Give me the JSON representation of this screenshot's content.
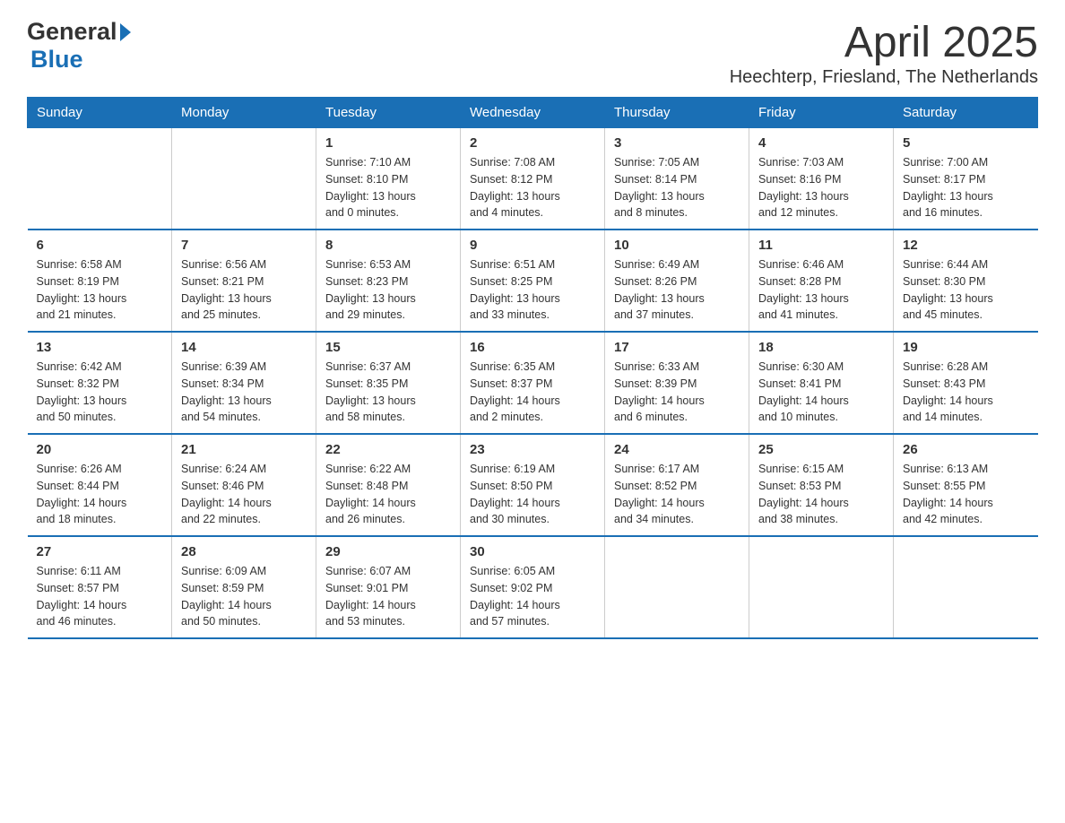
{
  "header": {
    "logo": {
      "general": "General",
      "blue": "Blue"
    },
    "month": "April 2025",
    "location": "Heechterp, Friesland, The Netherlands"
  },
  "days_of_week": [
    "Sunday",
    "Monday",
    "Tuesday",
    "Wednesday",
    "Thursday",
    "Friday",
    "Saturday"
  ],
  "weeks": [
    [
      {
        "day": "",
        "sunrise": "",
        "sunset": "",
        "daylight": ""
      },
      {
        "day": "",
        "sunrise": "",
        "sunset": "",
        "daylight": ""
      },
      {
        "day": "1",
        "sunrise": "Sunrise: 7:10 AM",
        "sunset": "Sunset: 8:10 PM",
        "daylight": "Daylight: 13 hours and 0 minutes."
      },
      {
        "day": "2",
        "sunrise": "Sunrise: 7:08 AM",
        "sunset": "Sunset: 8:12 PM",
        "daylight": "Daylight: 13 hours and 4 minutes."
      },
      {
        "day": "3",
        "sunrise": "Sunrise: 7:05 AM",
        "sunset": "Sunset: 8:14 PM",
        "daylight": "Daylight: 13 hours and 8 minutes."
      },
      {
        "day": "4",
        "sunrise": "Sunrise: 7:03 AM",
        "sunset": "Sunset: 8:16 PM",
        "daylight": "Daylight: 13 hours and 12 minutes."
      },
      {
        "day": "5",
        "sunrise": "Sunrise: 7:00 AM",
        "sunset": "Sunset: 8:17 PM",
        "daylight": "Daylight: 13 hours and 16 minutes."
      }
    ],
    [
      {
        "day": "6",
        "sunrise": "Sunrise: 6:58 AM",
        "sunset": "Sunset: 8:19 PM",
        "daylight": "Daylight: 13 hours and 21 minutes."
      },
      {
        "day": "7",
        "sunrise": "Sunrise: 6:56 AM",
        "sunset": "Sunset: 8:21 PM",
        "daylight": "Daylight: 13 hours and 25 minutes."
      },
      {
        "day": "8",
        "sunrise": "Sunrise: 6:53 AM",
        "sunset": "Sunset: 8:23 PM",
        "daylight": "Daylight: 13 hours and 29 minutes."
      },
      {
        "day": "9",
        "sunrise": "Sunrise: 6:51 AM",
        "sunset": "Sunset: 8:25 PM",
        "daylight": "Daylight: 13 hours and 33 minutes."
      },
      {
        "day": "10",
        "sunrise": "Sunrise: 6:49 AM",
        "sunset": "Sunset: 8:26 PM",
        "daylight": "Daylight: 13 hours and 37 minutes."
      },
      {
        "day": "11",
        "sunrise": "Sunrise: 6:46 AM",
        "sunset": "Sunset: 8:28 PM",
        "daylight": "Daylight: 13 hours and 41 minutes."
      },
      {
        "day": "12",
        "sunrise": "Sunrise: 6:44 AM",
        "sunset": "Sunset: 8:30 PM",
        "daylight": "Daylight: 13 hours and 45 minutes."
      }
    ],
    [
      {
        "day": "13",
        "sunrise": "Sunrise: 6:42 AM",
        "sunset": "Sunset: 8:32 PM",
        "daylight": "Daylight: 13 hours and 50 minutes."
      },
      {
        "day": "14",
        "sunrise": "Sunrise: 6:39 AM",
        "sunset": "Sunset: 8:34 PM",
        "daylight": "Daylight: 13 hours and 54 minutes."
      },
      {
        "day": "15",
        "sunrise": "Sunrise: 6:37 AM",
        "sunset": "Sunset: 8:35 PM",
        "daylight": "Daylight: 13 hours and 58 minutes."
      },
      {
        "day": "16",
        "sunrise": "Sunrise: 6:35 AM",
        "sunset": "Sunset: 8:37 PM",
        "daylight": "Daylight: 14 hours and 2 minutes."
      },
      {
        "day": "17",
        "sunrise": "Sunrise: 6:33 AM",
        "sunset": "Sunset: 8:39 PM",
        "daylight": "Daylight: 14 hours and 6 minutes."
      },
      {
        "day": "18",
        "sunrise": "Sunrise: 6:30 AM",
        "sunset": "Sunset: 8:41 PM",
        "daylight": "Daylight: 14 hours and 10 minutes."
      },
      {
        "day": "19",
        "sunrise": "Sunrise: 6:28 AM",
        "sunset": "Sunset: 8:43 PM",
        "daylight": "Daylight: 14 hours and 14 minutes."
      }
    ],
    [
      {
        "day": "20",
        "sunrise": "Sunrise: 6:26 AM",
        "sunset": "Sunset: 8:44 PM",
        "daylight": "Daylight: 14 hours and 18 minutes."
      },
      {
        "day": "21",
        "sunrise": "Sunrise: 6:24 AM",
        "sunset": "Sunset: 8:46 PM",
        "daylight": "Daylight: 14 hours and 22 minutes."
      },
      {
        "day": "22",
        "sunrise": "Sunrise: 6:22 AM",
        "sunset": "Sunset: 8:48 PM",
        "daylight": "Daylight: 14 hours and 26 minutes."
      },
      {
        "day": "23",
        "sunrise": "Sunrise: 6:19 AM",
        "sunset": "Sunset: 8:50 PM",
        "daylight": "Daylight: 14 hours and 30 minutes."
      },
      {
        "day": "24",
        "sunrise": "Sunrise: 6:17 AM",
        "sunset": "Sunset: 8:52 PM",
        "daylight": "Daylight: 14 hours and 34 minutes."
      },
      {
        "day": "25",
        "sunrise": "Sunrise: 6:15 AM",
        "sunset": "Sunset: 8:53 PM",
        "daylight": "Daylight: 14 hours and 38 minutes."
      },
      {
        "day": "26",
        "sunrise": "Sunrise: 6:13 AM",
        "sunset": "Sunset: 8:55 PM",
        "daylight": "Daylight: 14 hours and 42 minutes."
      }
    ],
    [
      {
        "day": "27",
        "sunrise": "Sunrise: 6:11 AM",
        "sunset": "Sunset: 8:57 PM",
        "daylight": "Daylight: 14 hours and 46 minutes."
      },
      {
        "day": "28",
        "sunrise": "Sunrise: 6:09 AM",
        "sunset": "Sunset: 8:59 PM",
        "daylight": "Daylight: 14 hours and 50 minutes."
      },
      {
        "day": "29",
        "sunrise": "Sunrise: 6:07 AM",
        "sunset": "Sunset: 9:01 PM",
        "daylight": "Daylight: 14 hours and 53 minutes."
      },
      {
        "day": "30",
        "sunrise": "Sunrise: 6:05 AM",
        "sunset": "Sunset: 9:02 PM",
        "daylight": "Daylight: 14 hours and 57 minutes."
      },
      {
        "day": "",
        "sunrise": "",
        "sunset": "",
        "daylight": ""
      },
      {
        "day": "",
        "sunrise": "",
        "sunset": "",
        "daylight": ""
      },
      {
        "day": "",
        "sunrise": "",
        "sunset": "",
        "daylight": ""
      }
    ]
  ]
}
